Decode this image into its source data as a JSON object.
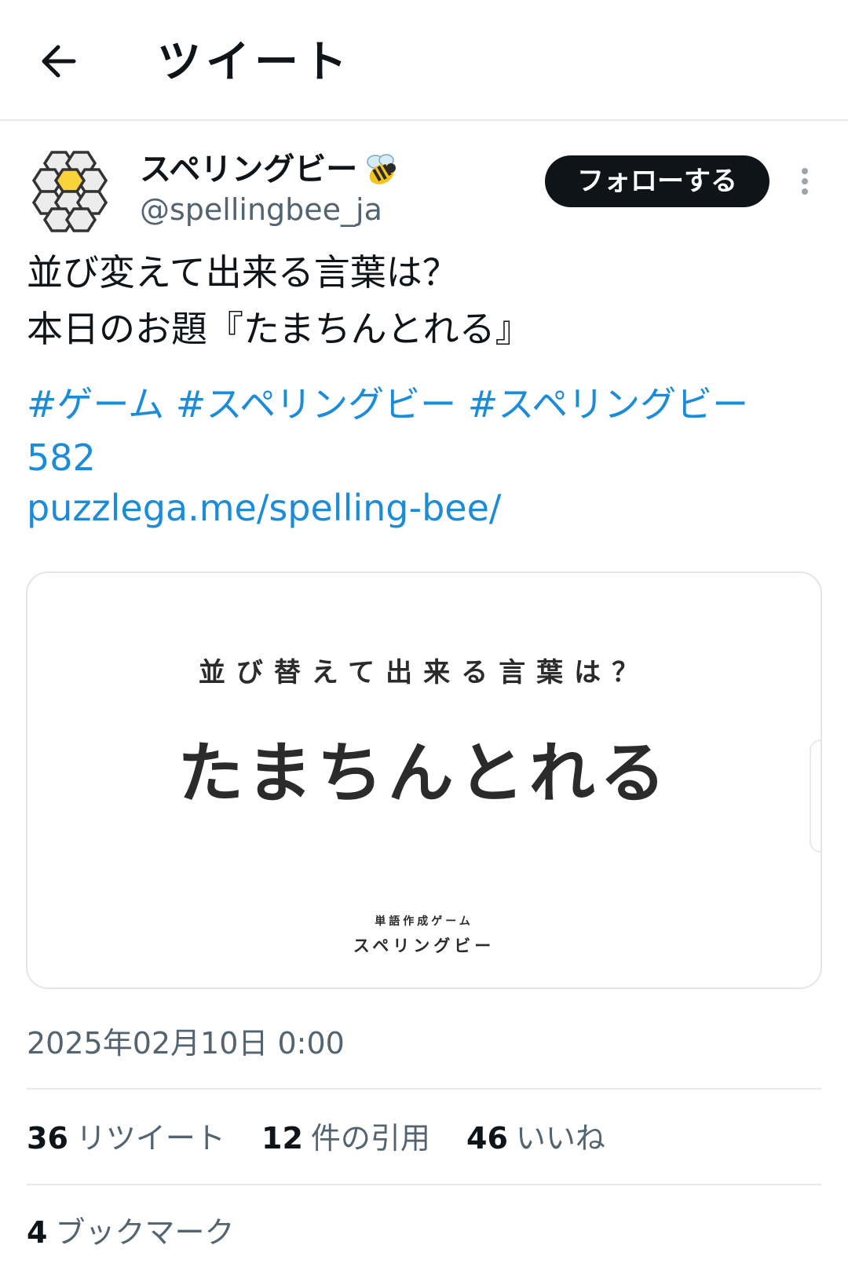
{
  "header": {
    "title": "ツイート",
    "back_icon": "arrow-left-icon"
  },
  "author": {
    "display_name": "スペリングビー",
    "emoji": "🐝",
    "handle": "@spellingbee_ja",
    "avatar_icon": "honeycomb-icon",
    "follow_label": "フォローする",
    "more_icon": "vertical-ellipsis-icon"
  },
  "tweet": {
    "line1": "並び変えて出来る言葉は？",
    "line2": "本日のお題『たまちんとれる』",
    "hashtags": [
      "#ゲーム",
      "#スペリングビー",
      "#スペリングビー"
    ],
    "hashtag_tail": "582",
    "url": "puzzlega.me/spelling-bee/"
  },
  "card": {
    "question": "並び替えて出来る言葉は？",
    "word": "たまちんとれる",
    "subtitle": "単語作成ゲーム",
    "brand": "スペリングビー"
  },
  "timestamp": "2025年02月10日 0:00",
  "stats": {
    "retweets_count": "36",
    "retweets_label": "リツイート",
    "quotes_count": "12",
    "quotes_label": "件の引用",
    "likes_count": "46",
    "likes_label": "いいね",
    "bookmarks_count": "4",
    "bookmarks_label": "ブックマーク"
  },
  "colors": {
    "link": "#1d8cd8",
    "follow_bg": "#0f1419",
    "muted_text": "#536471",
    "honeycomb_center": "#f8d33a"
  }
}
